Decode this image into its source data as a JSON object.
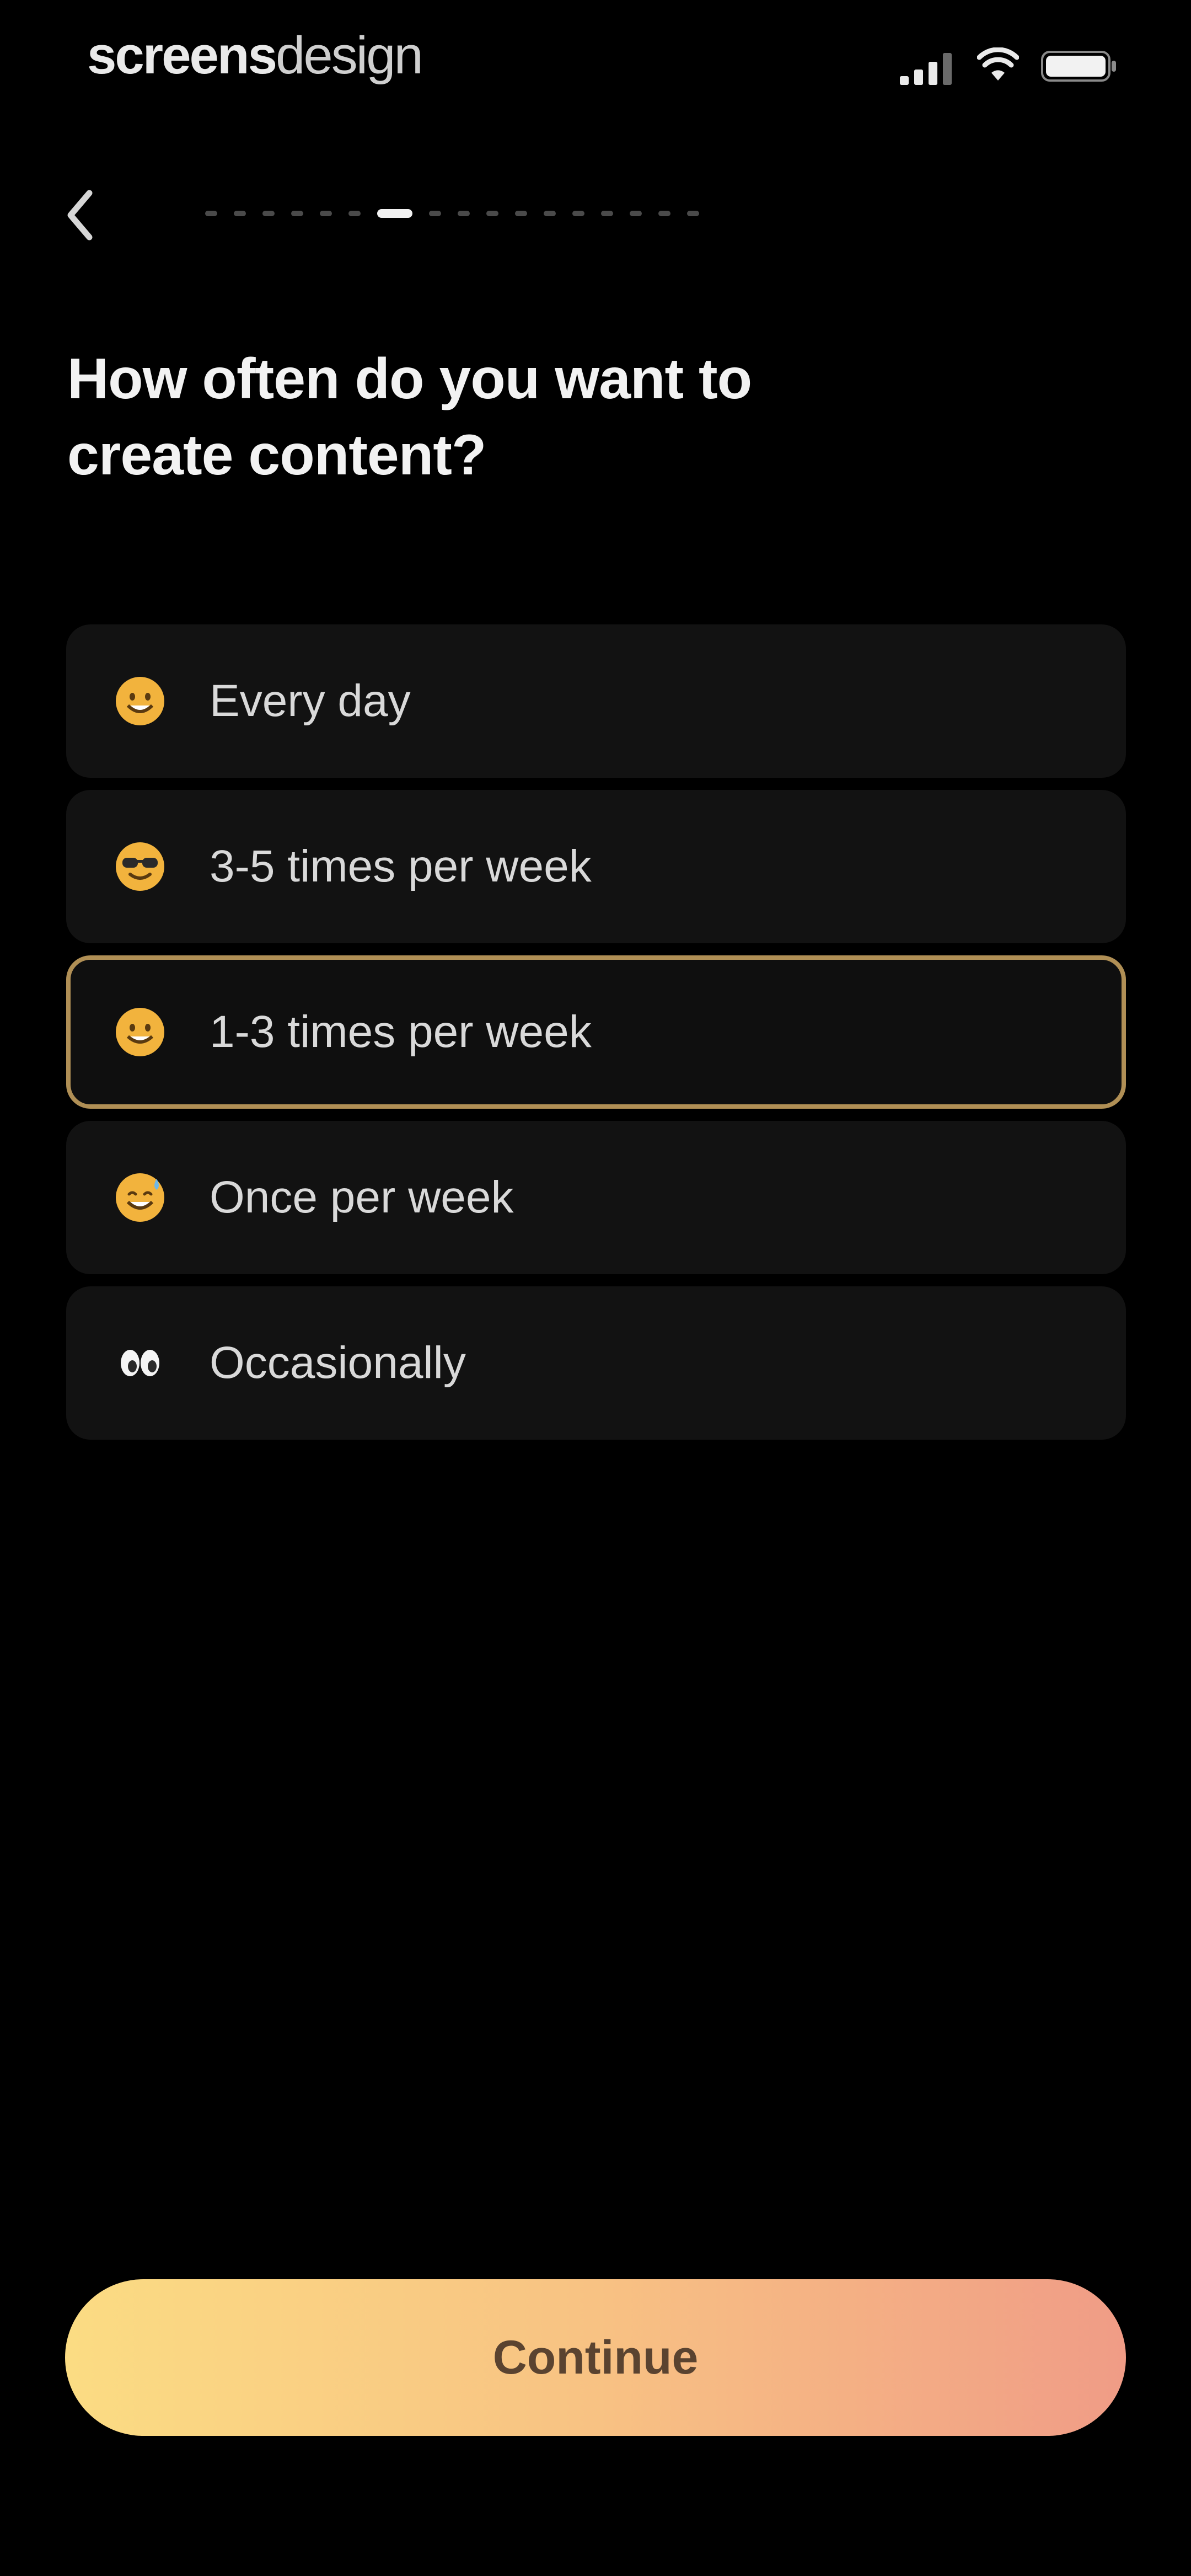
{
  "status_bar": {
    "brand_part1": "screens",
    "brand_part2": "design",
    "signal_icon": "cellular-signal-icon",
    "wifi_icon": "wifi-icon",
    "battery_icon": "battery-icon"
  },
  "nav": {
    "back_icon": "chevron-left-icon",
    "progress": {
      "total_steps": 17,
      "current_step": 7
    }
  },
  "title": "How often do you want to create content?",
  "options": [
    {
      "label": "Every day",
      "icon": "emoji-smile-icon",
      "selected": false
    },
    {
      "label": "3-5 times per week",
      "icon": "emoji-sunglasses-icon",
      "selected": false
    },
    {
      "label": "1-3 times per week",
      "icon": "emoji-smile-icon",
      "selected": true
    },
    {
      "label": "Once per week",
      "icon": "emoji-sweat-smile-icon",
      "selected": false
    },
    {
      "label": "Occasionally",
      "icon": "eyes-icon",
      "selected": false
    }
  ],
  "continue_label": "Continue",
  "colors": {
    "background": "#000000",
    "option_background": "#121212",
    "selected_border": "#b08f55",
    "continue_gradient_start": "#fbdc83",
    "continue_gradient_end": "#f09c86"
  }
}
